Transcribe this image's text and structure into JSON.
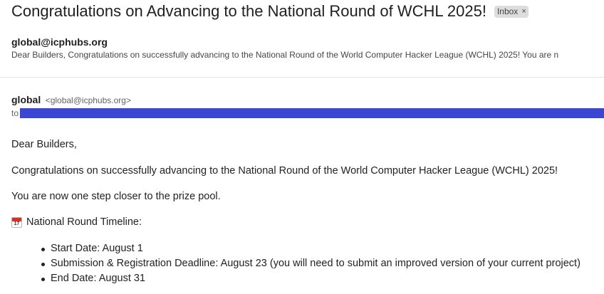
{
  "subject": "Congratulations on Advancing to the National Round of WCHL 2025!",
  "label_chip": {
    "text": "Inbox",
    "remove_glyph": "×"
  },
  "thread_item": {
    "sender": "global@icphubs.org",
    "snippet": "Dear Builders, Congratulations on successfully advancing to the National Round of the World Computer Hacker League (WCHL) 2025! You are n"
  },
  "message": {
    "from_name": "global",
    "from_email": "<global@icphubs.org>",
    "to_prefix": "to",
    "redaction_color": "#3b47d2"
  },
  "body": {
    "greeting": "Dear Builders,",
    "congrats": "Congratulations on successfully advancing to the National Round of the World Computer Hacker League (WCHL) 2025!",
    "closer": "You are now one step closer to the prize pool.",
    "timeline_icon": "calendar-icon",
    "timeline_icon_number": "17",
    "timeline_heading": "National Round Timeline:",
    "timeline_items": [
      "Start Date: August 1",
      "Submission & Registration Deadline: August 23 (you will need to submit an improved version of your current project)",
      "End Date: August 31"
    ]
  }
}
